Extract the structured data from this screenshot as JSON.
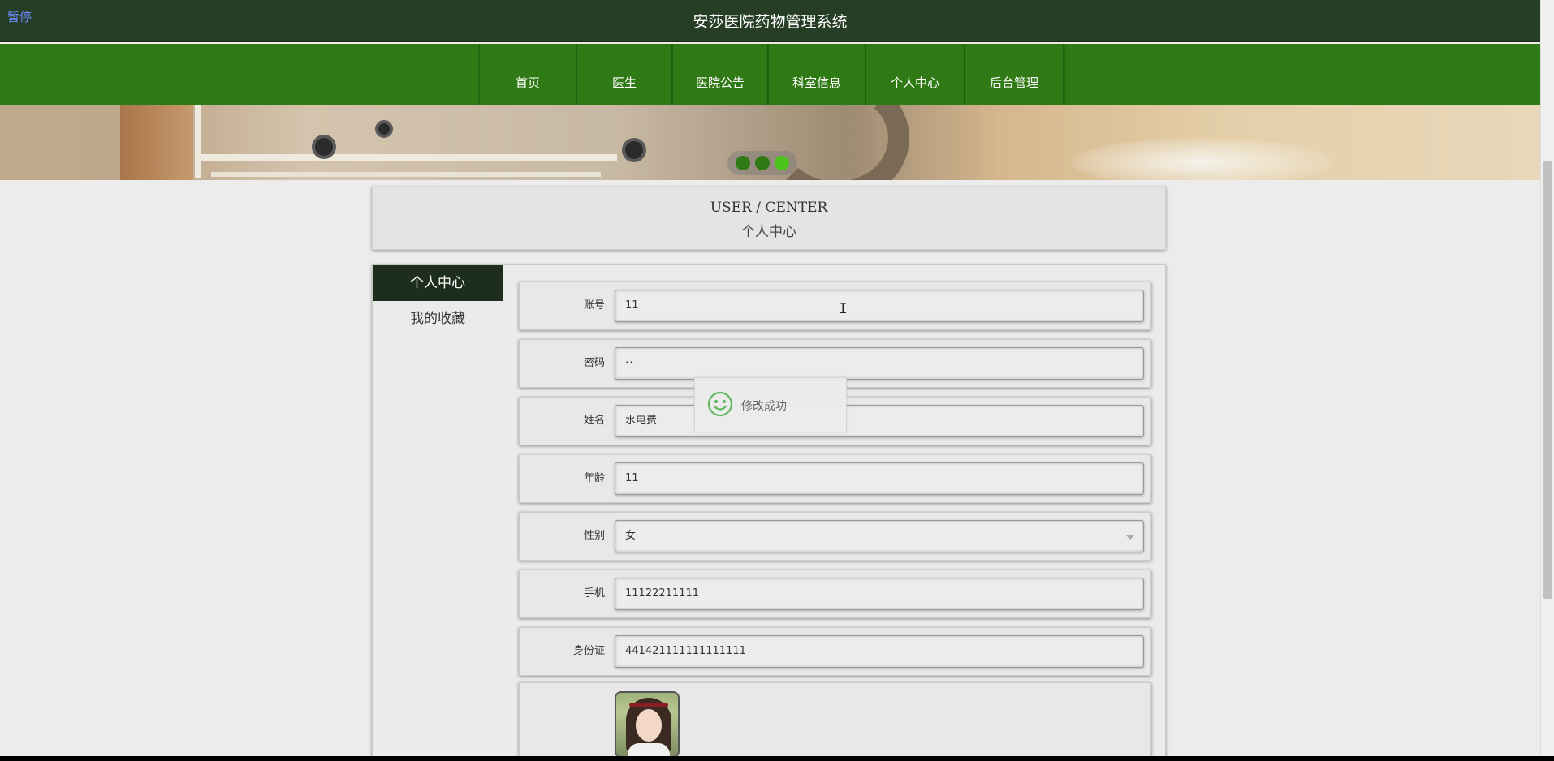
{
  "header": {
    "pause_label": "暂停",
    "site_title": "安莎医院药物管理系统"
  },
  "nav": {
    "items": [
      {
        "label": "首页"
      },
      {
        "label": "医生"
      },
      {
        "label": "医院公告"
      },
      {
        "label": "科室信息"
      },
      {
        "label": "个人中心"
      },
      {
        "label": "后台管理"
      }
    ]
  },
  "banner": {
    "carousel_slides": 3,
    "active_slide": 3
  },
  "user_center": {
    "title_en": "USER / CENTER",
    "title_zh": "个人中心"
  },
  "sidebar": {
    "items": [
      {
        "label": "个人中心",
        "active": true
      },
      {
        "label": "我的收藏",
        "active": false
      }
    ]
  },
  "form": {
    "fields": [
      {
        "label": "账号",
        "value": "11"
      },
      {
        "label": "密码",
        "value": "••"
      },
      {
        "label": "姓名",
        "value": "水电费"
      },
      {
        "label": "年龄",
        "value": "11"
      },
      {
        "label": "性别",
        "value": "女"
      },
      {
        "label": "手机",
        "value": "11122211111"
      },
      {
        "label": "身份证",
        "value": "441421111111111111"
      }
    ]
  },
  "toast": {
    "icon": "smile-icon",
    "message": "修改成功"
  },
  "colors": {
    "topbar": "#263d26",
    "navbar": "#2f7a15",
    "sidebar_active": "#1d2e1d",
    "dot_active": "#4cc41c"
  }
}
